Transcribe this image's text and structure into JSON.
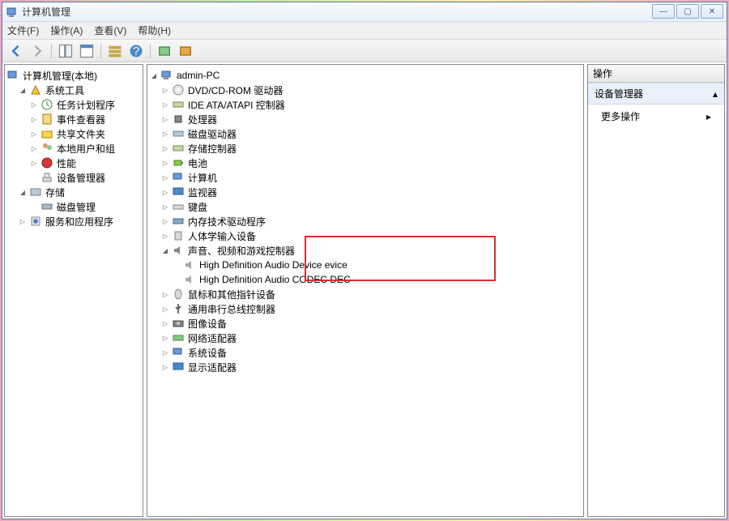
{
  "window": {
    "title": "计算机管理"
  },
  "menus": {
    "file": "文件(F)",
    "action": "操作(A)",
    "view": "查看(V)",
    "help": "帮助(H)"
  },
  "left_tree": {
    "root": "计算机管理(本地)",
    "system_tools": "系统工具",
    "task_scheduler": "任务计划程序",
    "event_viewer": "事件查看器",
    "shared_folders": "共享文件夹",
    "local_users": "本地用户和组",
    "performance": "性能",
    "device_manager": "设备管理器",
    "storage": "存储",
    "disk_management": "磁盘管理",
    "services": "服务和应用程序"
  },
  "center_tree": {
    "root": "admin-PC",
    "dvd": "DVD/CD-ROM 驱动器",
    "ide": "IDE ATA/ATAPI 控制器",
    "cpu": "处理器",
    "disk_drives": "磁盘驱动器",
    "storage_ctrl": "存储控制器",
    "battery": "电池",
    "computer": "计算机",
    "monitor": "监视器",
    "keyboard": "键盘",
    "memory_tech": "内存技术驱动程序",
    "hid": "人体学输入设备",
    "sound": "声音、视频和游戏控制器",
    "hd_audio_device": "High Definition Audio Device evice",
    "hd_audio_codec": "High Definition Audio CODEC DEC",
    "mouse": "鼠标和其他指针设备",
    "usb": "通用串行总线控制器",
    "imaging": "图像设备",
    "network": "网络适配器",
    "system_devices": "系统设备",
    "display": "显示适配器"
  },
  "actions": {
    "header": "操作",
    "section": "设备管理器",
    "more": "更多操作"
  }
}
